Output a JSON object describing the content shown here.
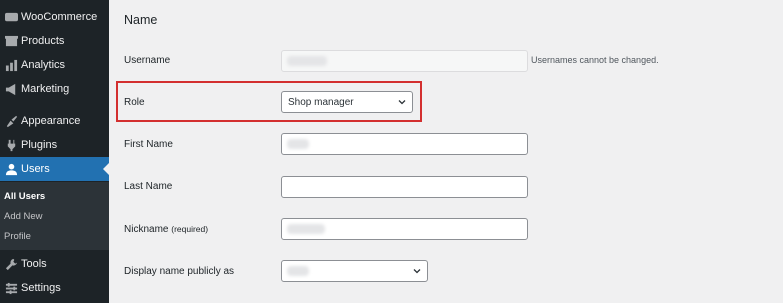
{
  "sidebar": {
    "items": [
      {
        "label": "WooCommerce",
        "icon": "woo-icon"
      },
      {
        "label": "Products",
        "icon": "products-icon"
      },
      {
        "label": "Analytics",
        "icon": "analytics-icon"
      },
      {
        "label": "Marketing",
        "icon": "marketing-icon"
      },
      {
        "label": "Appearance",
        "icon": "appearance-icon"
      },
      {
        "label": "Plugins",
        "icon": "plugins-icon"
      },
      {
        "label": "Users",
        "icon": "users-icon"
      },
      {
        "label": "Tools",
        "icon": "tools-icon"
      },
      {
        "label": "Settings",
        "icon": "settings-icon"
      }
    ],
    "submenu": [
      "All Users",
      "Add New",
      "Profile"
    ]
  },
  "form": {
    "heading": "Name",
    "username": {
      "label": "Username",
      "helper": "Usernames cannot be changed."
    },
    "role": {
      "label": "Role",
      "value": "Shop manager"
    },
    "first_name": {
      "label": "First Name"
    },
    "last_name": {
      "label": "Last Name"
    },
    "nickname": {
      "label": "Nickname",
      "note": "(required)"
    },
    "display_name": {
      "label": "Display name publicly as"
    }
  },
  "colors": {
    "sidebar": "#1d2327",
    "active": "#2271b1",
    "highlight": "#d32f2f"
  }
}
